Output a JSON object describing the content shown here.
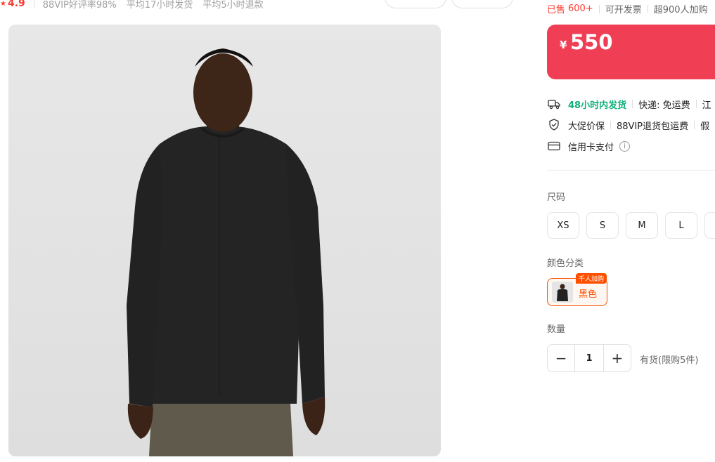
{
  "header": {
    "rating": "4.9",
    "stats": [
      "88VIP好评率98%",
      "平均17小时发货",
      "平均5小时退款"
    ]
  },
  "image": {
    "alt_subject": "black-long-sleeve-tee-model"
  },
  "sales": {
    "sold_prefix": "已售",
    "sold_count": "600+",
    "invoice": "可开发票",
    "cart_count": "超900人加购"
  },
  "price": {
    "currency": "¥",
    "value": "550",
    "accent_color": "#f03e55"
  },
  "services": {
    "shipping": {
      "icon": "delivery-truck-icon",
      "highlight": "48小时内发货",
      "express": "快递: 免运费",
      "origin": "江"
    },
    "protection": {
      "icon": "shield-hand-icon",
      "price_protect": "大促价保",
      "return": "88VIP退货包运费",
      "more": "假"
    },
    "payment": {
      "icon": "credit-card-icon",
      "label": "信用卡支付"
    }
  },
  "size": {
    "label": "尺码",
    "options": [
      "XS",
      "S",
      "M",
      "L"
    ]
  },
  "color": {
    "label": "颜色分类",
    "selected": "黑色",
    "badge": "千人加购",
    "accent": "#ff5000"
  },
  "quantity": {
    "label": "数量",
    "value": "1",
    "stock_note": "有货(限购5件)"
  }
}
